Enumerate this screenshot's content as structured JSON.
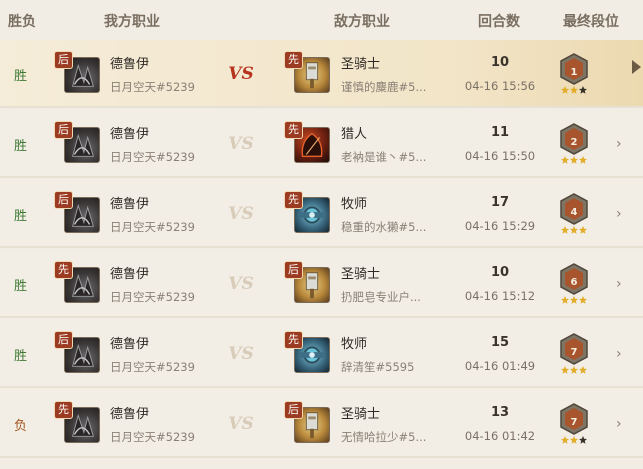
{
  "headers": {
    "result": "胜负",
    "my_class": "我方职业",
    "enemy_class": "敌方职业",
    "rounds": "回合数",
    "final_rank": "最终段位"
  },
  "colors": {
    "win": "#3f7a35",
    "loss": "#a2551f",
    "badge": "#9b3b22",
    "highlight": "#f2e5c8"
  },
  "rows": [
    {
      "result": "胜",
      "outcome": "win",
      "my_order": "后",
      "my_class": "德鲁伊",
      "my_player": "日月空天#5239",
      "my_icon": "druid-portrait-icon",
      "enemy_order": "先",
      "enemy_class": "圣骑士",
      "enemy_player": "谨慎的麋鹿#5...",
      "enemy_icon": "paladin-portrait-icon",
      "rounds": "10",
      "time": "04-16 15:56",
      "rank": "1",
      "stars": 2,
      "highlighted": true
    },
    {
      "result": "胜",
      "outcome": "win",
      "my_order": "后",
      "my_class": "德鲁伊",
      "my_player": "日月空天#5239",
      "my_icon": "druid-portrait-icon",
      "enemy_order": "先",
      "enemy_class": "猎人",
      "enemy_player": "老衲是谁丶#5...",
      "enemy_icon": "hunter-portrait-icon",
      "rounds": "11",
      "time": "04-16 15:50",
      "rank": "2",
      "stars": 3,
      "highlighted": false
    },
    {
      "result": "胜",
      "outcome": "win",
      "my_order": "后",
      "my_class": "德鲁伊",
      "my_player": "日月空天#5239",
      "my_icon": "druid-portrait-icon",
      "enemy_order": "先",
      "enemy_class": "牧师",
      "enemy_player": "稳重的水獭#5...",
      "enemy_icon": "priest-portrait-icon",
      "rounds": "17",
      "time": "04-16 15:29",
      "rank": "4",
      "stars": 3,
      "highlighted": false
    },
    {
      "result": "胜",
      "outcome": "win",
      "my_order": "先",
      "my_class": "德鲁伊",
      "my_player": "日月空天#5239",
      "my_icon": "druid-portrait-icon",
      "enemy_order": "后",
      "enemy_class": "圣骑士",
      "enemy_player": "扔肥皂专业户...",
      "enemy_icon": "paladin-portrait-icon",
      "rounds": "10",
      "time": "04-16 15:12",
      "rank": "6",
      "stars": 3,
      "highlighted": false
    },
    {
      "result": "胜",
      "outcome": "win",
      "my_order": "后",
      "my_class": "德鲁伊",
      "my_player": "日月空天#5239",
      "my_icon": "druid-portrait-icon",
      "enemy_order": "先",
      "enemy_class": "牧师",
      "enemy_player": "辞清笙#5595",
      "enemy_icon": "priest-portrait-icon",
      "rounds": "15",
      "time": "04-16 01:49",
      "rank": "7",
      "stars": 3,
      "highlighted": false
    },
    {
      "result": "负",
      "outcome": "loss",
      "my_order": "先",
      "my_class": "德鲁伊",
      "my_player": "日月空天#5239",
      "my_icon": "druid-portrait-icon",
      "enemy_order": "后",
      "enemy_class": "圣骑士",
      "enemy_player": "无情哈拉少#5...",
      "enemy_icon": "paladin-portrait-icon",
      "rounds": "13",
      "time": "04-16 01:42",
      "rank": "7",
      "stars": 2,
      "highlighted": false
    }
  ]
}
